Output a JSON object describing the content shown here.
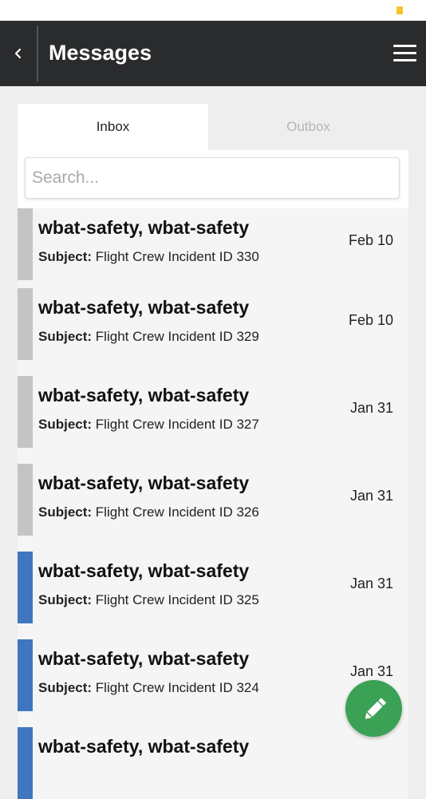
{
  "header": {
    "title": "Messages"
  },
  "tabs": [
    {
      "label": "Inbox",
      "active": true
    },
    {
      "label": "Outbox",
      "active": false
    }
  ],
  "search": {
    "placeholder": "Search...",
    "value": ""
  },
  "colors": {
    "unread_bar": "#3f76c0",
    "read_bar": "#c4c4c4",
    "compose_button": "#3ba255",
    "header_bg": "#2a2b2c"
  },
  "messages": [
    {
      "sender": "wbat-safety, wbat-safety",
      "subject_label": "Subject:",
      "subject": "Flight Crew Incident ID 330",
      "date": "Feb 10",
      "status": "read"
    },
    {
      "sender": "wbat-safety, wbat-safety",
      "subject_label": "Subject:",
      "subject": "Flight Crew Incident ID 329",
      "date": "Feb 10",
      "status": "read"
    },
    {
      "sender": "wbat-safety, wbat-safety",
      "subject_label": "Subject:",
      "subject": "Flight Crew Incident ID 327",
      "date": "Jan 31",
      "status": "read"
    },
    {
      "sender": "wbat-safety, wbat-safety",
      "subject_label": "Subject:",
      "subject": "Flight Crew Incident ID 326",
      "date": "Jan 31",
      "status": "read"
    },
    {
      "sender": "wbat-safety, wbat-safety",
      "subject_label": "Subject:",
      "subject": "Flight Crew Incident ID 325",
      "date": "Jan 31",
      "status": "unread"
    },
    {
      "sender": "wbat-safety, wbat-safety",
      "subject_label": "Subject:",
      "subject": "Flight Crew Incident ID 324",
      "date": "Jan 31",
      "status": "unread"
    },
    {
      "sender": "wbat-safety, wbat-safety",
      "status": "unread"
    }
  ],
  "icons": {
    "back": "chevron-left-icon",
    "menu": "hamburger-menu-icon",
    "compose": "pencil-icon"
  }
}
